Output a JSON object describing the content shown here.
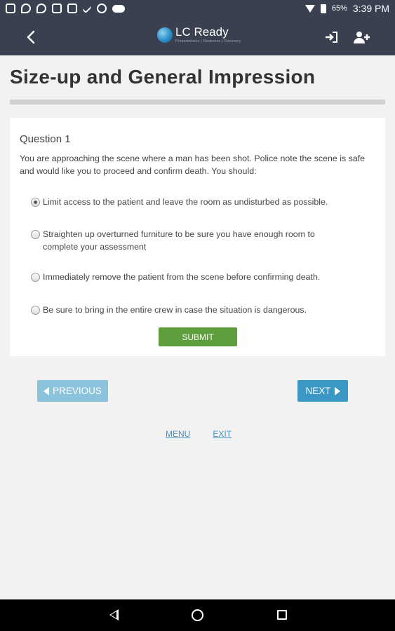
{
  "status_bar": {
    "battery_percent": "65%",
    "time": "3:39 PM",
    "left_icons": [
      "calendar-icon",
      "location-icon",
      "location-icon",
      "image-icon",
      "gallery-icon",
      "check-icon",
      "pinwheel-icon",
      "cloud-icon"
    ],
    "right_icons": [
      "wifi-icon",
      "battery-icon"
    ]
  },
  "app_bar": {
    "back_icon": "chevron-left-icon",
    "logo_text": "LC Ready",
    "logo_tagline": "Preparedness | Response | Recovery",
    "right_icons": [
      "login-icon",
      "add-user-icon"
    ],
    "background": "#3a4050"
  },
  "page": {
    "title": "Size-up and General Impression"
  },
  "question": {
    "number_label": "Question 1",
    "text": "You are approaching the scene where a man has been shot. Police note the scene is safe and would like you to proceed and confirm death. You should:",
    "options": [
      {
        "label": "Limit access to the patient and leave the room as undisturbed as possible.",
        "selected": true
      },
      {
        "label": "Straighten up overturned furniture to be sure you have enough room to complete your assessment",
        "selected": false
      },
      {
        "label": "Immediately remove the patient from the scene before confirming death.",
        "selected": false
      },
      {
        "label": "Be sure to bring in the entire crew in case the situation is dangerous.",
        "selected": false
      }
    ],
    "submit_label": "SUBMIT",
    "submit_color": "#5f9e3c"
  },
  "navigation": {
    "previous_label": "PREVIOUS",
    "next_label": "NEXT",
    "previous_color": "#8bc3dc",
    "next_color": "#3b98c5"
  },
  "footer": {
    "menu_label": "MENU",
    "exit_label": "EXIT"
  },
  "system_nav": {
    "icons": [
      "back-triangle-icon",
      "home-circle-icon",
      "recents-square-icon"
    ]
  }
}
